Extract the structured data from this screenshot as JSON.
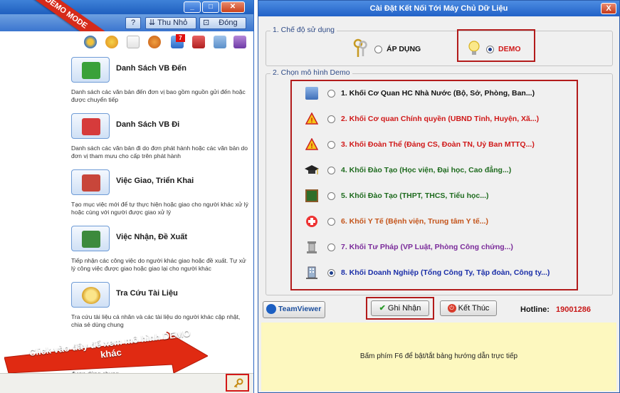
{
  "left": {
    "demo_ribbon": "DEMO MODE",
    "toolbar": {
      "help_label": "?",
      "minimize_label": "Thu Nhỏ",
      "close_label": "Đóng"
    },
    "badge_count": "7",
    "menu_items": [
      {
        "title": "Danh Sách VB Đến",
        "desc": "Danh sách các văn bản đến đơn vị bao gồm nguồn gửi đến hoặc được chuyển tiếp",
        "color": "#3aa13a"
      },
      {
        "title": "Danh Sách VB Đi",
        "desc": "Danh sách các văn bản đi do đơn phát hành hoặc các văn bản do đơn vị tham mưu cho cấp trên phát hành",
        "color": "#d63b3b"
      },
      {
        "title": "Việc Giao, Triển Khai",
        "desc": "Tạo mục việc mới để tự thực hiện hoặc giao cho người khác xử lý hoặc cùng với người được giao xử lý",
        "color": "#c8463a"
      },
      {
        "title": "Việc Nhận, Đề Xuất",
        "desc": "Tiếp nhận các công việc do người khác giao hoặc đề xuất. Tự xử lý công việc được giao hoặc giao lại cho người khác",
        "color": "#3c8a3c"
      },
      {
        "title": "Tra Cứu Tài Liệu",
        "desc": "Tra cứu tài liệu cá nhân và các tài liệu do người khác cập nhật, chia sẻ dùng chung",
        "color": "#d9a32a"
      }
    ],
    "partial_desc": "được dùng chung",
    "arrow_text": "Click vào đây để xem mô hình DEMO khác"
  },
  "right": {
    "title": "Cài Đặt Kết Nối Tới Máy Chủ Dữ Liệu",
    "close_label": "X",
    "section1": {
      "legend": "1. Chế độ sử dụng",
      "option_apply": "ÁP DỤNG",
      "option_demo": "DEMO",
      "selected": "demo"
    },
    "section2": {
      "legend": "2. Chọn mô hình Demo",
      "options": [
        {
          "label": "1. Khối Cơ Quan HC Nhà Nước (Bộ, Sở, Phòng, Ban...)",
          "color": "#111111",
          "icon": "building-icon",
          "selected": false
        },
        {
          "label": "2. Khối Cơ quan Chính quyền (UBND Tỉnh, Huyện, Xã...)",
          "color": "#d01818",
          "icon": "warning-icon",
          "selected": false
        },
        {
          "label": "3. Khối Đoàn Thể (Đảng CS, Đoàn TN, Uỷ Ban MTTQ...)",
          "color": "#d01818",
          "icon": "warning-icon",
          "selected": false
        },
        {
          "label": "4. Khối Đào Tạo (Học viện, Đại học, Cao đẳng...)",
          "color": "#1e6b1e",
          "icon": "graduation-cap-icon",
          "selected": false
        },
        {
          "label": "5. Khối Đào Tạo (THPT, THCS, Tiểu học...)",
          "color": "#1e6b1e",
          "icon": "blackboard-icon",
          "selected": false
        },
        {
          "label": "6. Khối Y Tế (Bệnh viện, Trung tâm Y tế...)",
          "color": "#c4541a",
          "icon": "medical-cross-icon",
          "selected": false
        },
        {
          "label": "7. Khối Tư Pháp (VP Luật, Phòng Công chứng...)",
          "color": "#7a2a9a",
          "icon": "pillar-icon",
          "selected": false
        },
        {
          "label": "8. Khối Doanh Nghiệp (Tổng Công Ty, Tập đoàn, Công ty...)",
          "color": "#1a2ea8",
          "icon": "office-building-icon",
          "selected": true
        }
      ]
    },
    "teamviewer_label": "TeamViewer",
    "save_label": "Ghi Nhận",
    "exit_label": "Kết Thúc",
    "hotline_label": "Hotline:",
    "hotline_number": "19001286",
    "hint": "Bấm phím F6 để bật/tắt bảng hướng dẫn trực tiếp"
  }
}
